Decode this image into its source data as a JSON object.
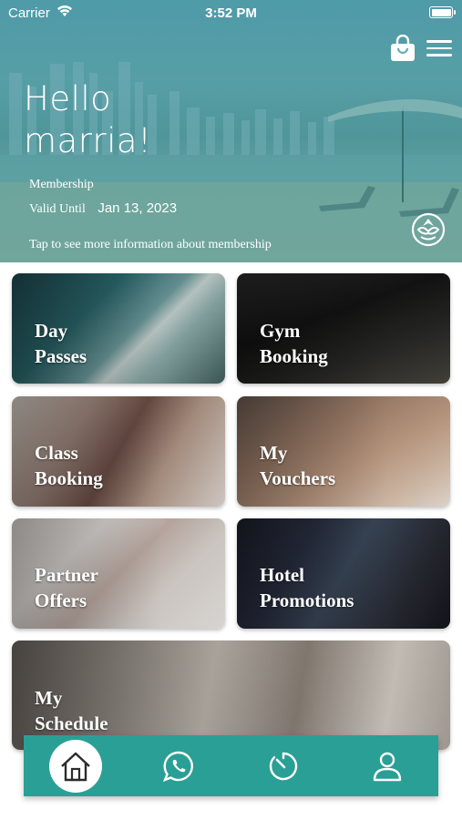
{
  "status_bar": {
    "carrier": "Carrier",
    "time": "3:52 PM"
  },
  "header": {
    "greeting": "Hello",
    "user_name": "marria!",
    "membership_label": "Membership",
    "valid_until_label": "Valid Until",
    "valid_until_date": "Jan 13, 2023",
    "info_text": "Tap to see more information about membership"
  },
  "tiles": [
    {
      "line1": "Day",
      "line2": "Passes"
    },
    {
      "line1": "Gym",
      "line2": "Booking"
    },
    {
      "line1": "Class",
      "line2": "Booking"
    },
    {
      "line1": "My",
      "line2": "Vouchers"
    },
    {
      "line1": "Partner",
      "line2": "Offers"
    },
    {
      "line1": "Hotel",
      "line2": "Promotions"
    },
    {
      "line1": "My",
      "line2": "Schedule"
    }
  ],
  "bottom_nav": {
    "items": [
      "home-icon",
      "whatsapp-icon",
      "timer-icon",
      "profile-icon"
    ],
    "active": "home-icon"
  },
  "colors": {
    "accent": "#2a9f96",
    "header_tint": "#5fa9b8",
    "text_on_dark": "#ffffff"
  }
}
